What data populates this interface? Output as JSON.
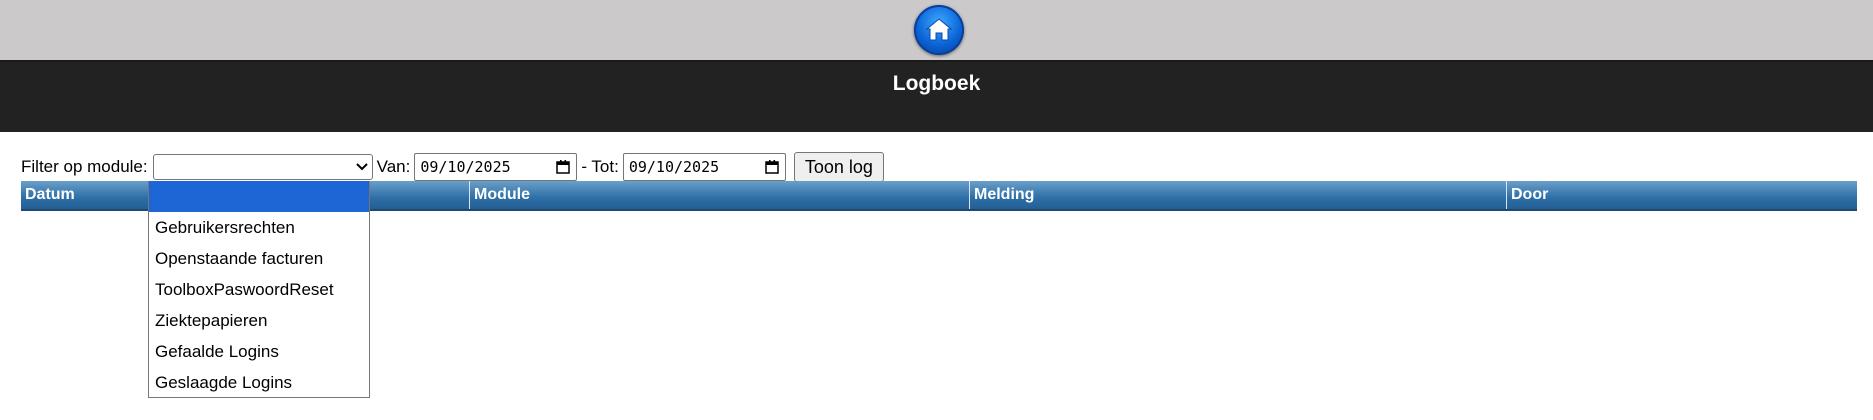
{
  "header": {
    "home_icon": "home-icon",
    "title": "Logboek"
  },
  "filter": {
    "module_label": "Filter op module:",
    "module_selected": "",
    "from_label": "Van:",
    "from_value": "09/10/2025",
    "to_label": "- Tot:",
    "to_value": "09/10/2025",
    "show_button": "Toon log"
  },
  "table": {
    "columns": [
      "Datum",
      "",
      "Module",
      "Melding",
      "Door"
    ]
  },
  "dropdown": {
    "options": [
      "",
      "Gebruikersrechten",
      "Openstaande facturen",
      "ToolboxPaswoordReset",
      "Ziektepapieren",
      "Gefaalde Logins",
      "Geslaagde Logins"
    ],
    "highlighted_index": 0
  },
  "colors": {
    "header_bar": "#cbc9ca",
    "title_bar": "#222222",
    "table_header": "#2d6fa6",
    "highlight": "#1e66d6"
  }
}
